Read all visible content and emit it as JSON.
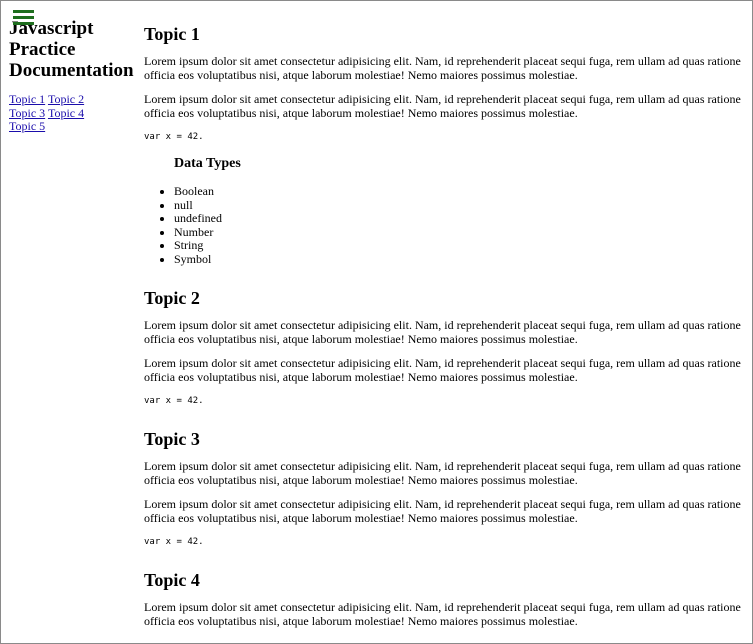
{
  "sidebar": {
    "title": "Javascript Practice Documentation",
    "nav": [
      "Topic 1",
      "Topic 2",
      "Topic 3",
      "Topic 4",
      "Topic 5"
    ]
  },
  "main": {
    "topic1": {
      "title": "Topic 1",
      "p1": "Lorem ipsum dolor sit amet consectetur adipisicing elit. Nam, id reprehenderit placeat sequi fuga, rem ullam ad quas ratione officia eos voluptatibus nisi, atque laborum molestiae! Nemo maiores possimus molestiae.",
      "p2": "Lorem ipsum dolor sit amet consectetur adipisicing elit. Nam, id reprehenderit placeat sequi fuga, rem ullam ad quas ratione officia eos voluptatibus nisi, atque laborum molestiae! Nemo maiores possimus molestiae.",
      "code": "var x = 42.",
      "subheading": "Data Types",
      "list": [
        "Boolean",
        "null",
        "undefined",
        "Number",
        "String",
        "Symbol"
      ]
    },
    "topic2": {
      "title": "Topic 2",
      "p1": "Lorem ipsum dolor sit amet consectetur adipisicing elit. Nam, id reprehenderit placeat sequi fuga, rem ullam ad quas ratione officia eos voluptatibus nisi, atque laborum molestiae! Nemo maiores possimus molestiae.",
      "p2": "Lorem ipsum dolor sit amet consectetur adipisicing elit. Nam, id reprehenderit placeat sequi fuga, rem ullam ad quas ratione officia eos voluptatibus nisi, atque laborum molestiae! Nemo maiores possimus molestiae.",
      "code": "var x = 42."
    },
    "topic3": {
      "title": "Topic 3",
      "p1": "Lorem ipsum dolor sit amet consectetur adipisicing elit. Nam, id reprehenderit placeat sequi fuga, rem ullam ad quas ratione officia eos voluptatibus nisi, atque laborum molestiae! Nemo maiores possimus molestiae.",
      "p2": "Lorem ipsum dolor sit amet consectetur adipisicing elit. Nam, id reprehenderit placeat sequi fuga, rem ullam ad quas ratione officia eos voluptatibus nisi, atque laborum molestiae! Nemo maiores possimus molestiae.",
      "code": "var x = 42."
    },
    "topic4": {
      "title": "Topic 4",
      "p1": "Lorem ipsum dolor sit amet consectetur adipisicing elit. Nam, id reprehenderit placeat sequi fuga, rem ullam ad quas ratione officia eos voluptatibus nisi, atque laborum molestiae! Nemo maiores possimus molestiae."
    }
  },
  "colors": {
    "menu_icon": "#1e6e1e",
    "link": "#1a0dab"
  },
  "icons": {
    "menu": "hamburger-menu-icon"
  }
}
